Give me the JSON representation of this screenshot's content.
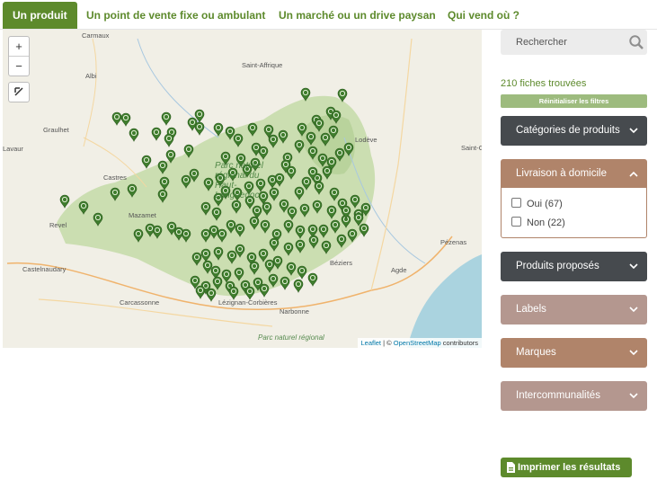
{
  "tabs": [
    {
      "label": "Un produit",
      "active": true
    },
    {
      "label": "Un point de vente fixe ou ambulant",
      "active": false
    },
    {
      "label": "Un marché ou un drive paysan",
      "active": false
    },
    {
      "label": "Qui vend où ?",
      "active": false
    }
  ],
  "map": {
    "zoom_in": "+",
    "zoom_out": "−",
    "places": [
      "Carmaux",
      "Saint-Affrique",
      "Albi",
      "Graulhet",
      "Lodève",
      "Saint-Gee",
      "Lavaur",
      "Castres",
      "Mazamet",
      "Revel",
      "Pézenas",
      "Béziers",
      "Agde",
      "Castelnaudary",
      "Carcassonne",
      "Lézignan-Corbières",
      "Narbonne"
    ],
    "park_labels": [
      "Parc naturel régional du Haut-Languedoc",
      "Parc naturel régional"
    ],
    "attribution": {
      "leaflet": "Leaflet",
      "separator": " | © ",
      "osm": "OpenStreetMap",
      "contributors": " contributors"
    },
    "colors": {
      "marker": "#3f7d2d",
      "park": "#c8dcae",
      "sea": "#aad3df"
    }
  },
  "sidebar": {
    "search_placeholder": "Rechercher",
    "result_count": "210 fiches trouvées",
    "reset_label": "Réinitialiser les filtres",
    "filters": [
      {
        "label": "Catégories de produits",
        "color": "#464a4e",
        "expanded": false
      },
      {
        "label": "Livraison à domicile",
        "color": "#b0846a",
        "expanded": true,
        "options": [
          {
            "label": "Oui (67)",
            "checked": false
          },
          {
            "label": "Non (22)",
            "checked": false
          }
        ]
      },
      {
        "label": "Produits proposés",
        "color": "#464a4e",
        "expanded": false
      },
      {
        "label": "Labels",
        "color": "#b4978f",
        "expanded": false
      },
      {
        "label": "Marques",
        "color": "#b0846a",
        "expanded": false
      },
      {
        "label": "Intercommunalités",
        "color": "#b4978f",
        "expanded": false
      }
    ],
    "print_label": "Imprimer les résultats"
  }
}
